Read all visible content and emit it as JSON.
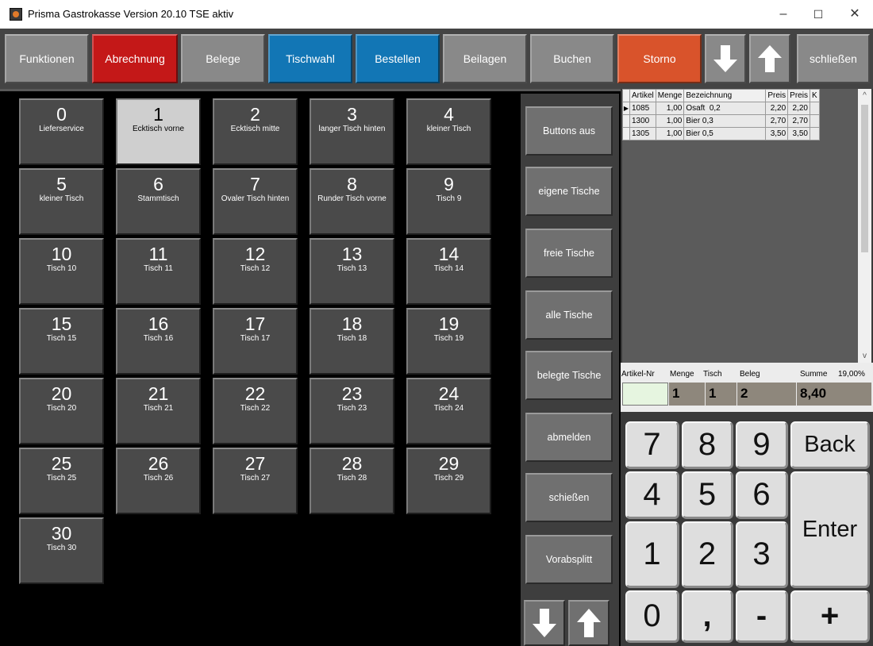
{
  "window": {
    "title": "Prisma Gastrokasse Version 20.10 TSE aktiv",
    "controls": [
      "–",
      "☐",
      "✕"
    ]
  },
  "toolbar": {
    "buttons": [
      {
        "label": "Funktionen",
        "color": "#898989"
      },
      {
        "label": "Abrechnung",
        "color": "#c41818"
      },
      {
        "label": "Belege",
        "color": "#898989"
      },
      {
        "label": "Tischwahl",
        "color": "#1276b5"
      },
      {
        "label": "Bestellen",
        "color": "#1276b5"
      },
      {
        "label": "Beilagen",
        "color": "#898989"
      },
      {
        "label": "Buchen",
        "color": "#898989"
      },
      {
        "label": "Storno",
        "color": "#d9532b"
      },
      {
        "label": "schließen",
        "color": "#898989"
      }
    ],
    "icons": [
      "arrow-down-icon",
      "arrow-up-icon"
    ]
  },
  "tables": [
    {
      "num": "0",
      "name": "Lieferservice"
    },
    {
      "num": "1",
      "name": "Ecktisch vorne",
      "selected": true
    },
    {
      "num": "2",
      "name": "Ecktisch mitte"
    },
    {
      "num": "3",
      "name": "langer Tisch hinten"
    },
    {
      "num": "4",
      "name": "kleiner Tisch"
    },
    {
      "num": "5",
      "name": "kleiner Tisch"
    },
    {
      "num": "6",
      "name": "Stammtisch"
    },
    {
      "num": "7",
      "name": "Ovaler Tisch hinten"
    },
    {
      "num": "8",
      "name": "Runder Tisch vorne"
    },
    {
      "num": "9",
      "name": "Tisch 9"
    },
    {
      "num": "10",
      "name": "Tisch 10"
    },
    {
      "num": "11",
      "name": "Tisch 11"
    },
    {
      "num": "12",
      "name": "Tisch 12"
    },
    {
      "num": "13",
      "name": "Tisch 13"
    },
    {
      "num": "14",
      "name": "Tisch 14"
    },
    {
      "num": "15",
      "name": "Tisch 15"
    },
    {
      "num": "16",
      "name": "Tisch 16"
    },
    {
      "num": "17",
      "name": "Tisch 17"
    },
    {
      "num": "18",
      "name": "Tisch 18"
    },
    {
      "num": "19",
      "name": "Tisch 19"
    },
    {
      "num": "20",
      "name": "Tisch 20"
    },
    {
      "num": "21",
      "name": "Tisch 21"
    },
    {
      "num": "22",
      "name": "Tisch 22"
    },
    {
      "num": "23",
      "name": "Tisch 23"
    },
    {
      "num": "24",
      "name": "Tisch 24"
    },
    {
      "num": "25",
      "name": "Tisch 25"
    },
    {
      "num": "26",
      "name": "Tisch 26"
    },
    {
      "num": "27",
      "name": "Tisch 27"
    },
    {
      "num": "28",
      "name": "Tisch 28"
    },
    {
      "num": "29",
      "name": "Tisch 29"
    },
    {
      "num": "30",
      "name": "Tisch 30"
    }
  ],
  "side_buttons": [
    "Buttons aus",
    "eigene Tische",
    "freie Tische",
    "alle Tische",
    "belegte Tische",
    "abmelden",
    "schießen",
    "Vorabsplitt"
  ],
  "order": {
    "columns": [
      "Artikel",
      "Menge",
      "Bezeichnung",
      "Preis",
      "Preis",
      "K"
    ],
    "rows": [
      {
        "artikel": "1085",
        "menge": "1,00",
        "bezeichnung": "Osaft  0,2",
        "preis": "2,20",
        "preis2": "2,20",
        "k": ""
      },
      {
        "artikel": "1300",
        "menge": "1,00",
        "bezeichnung": "Bier 0,3",
        "preis": "2,70",
        "preis2": "2,70",
        "k": ""
      },
      {
        "artikel": "1305",
        "menge": "1,00",
        "bezeichnung": "Bier 0,5",
        "preis": "3,50",
        "preis2": "3,50",
        "k": ""
      }
    ]
  },
  "totals": {
    "labels": {
      "artikel": "Artikel-Nr",
      "menge": "Menge",
      "tisch": "Tisch",
      "beleg": "Beleg",
      "summe": "Summe",
      "mwst": "19,00%"
    },
    "values": {
      "artikel": "",
      "menge": "1",
      "tisch": "1",
      "beleg": "2",
      "summe": "8,40"
    }
  },
  "numpad": {
    "keys": [
      "7",
      "8",
      "9",
      "Back",
      "4",
      "5",
      "6",
      "Enter",
      "1",
      "2",
      "3",
      "0",
      ",",
      "-",
      "+"
    ]
  }
}
